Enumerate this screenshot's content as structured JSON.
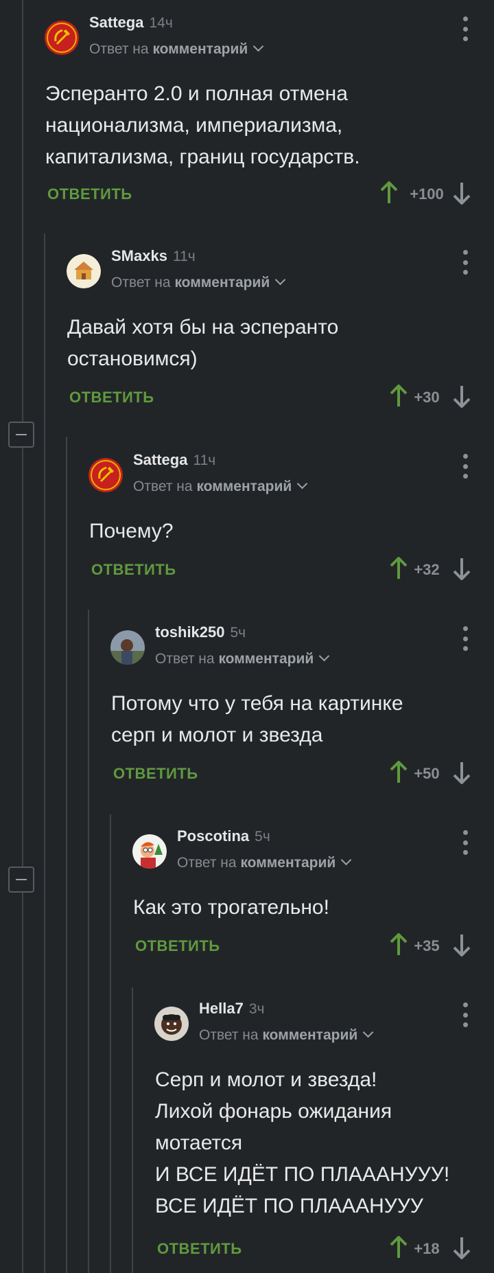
{
  "comments": [
    {
      "author": "Sattega",
      "time": "14ч",
      "reply_prefix": "Ответ на",
      "reply_target": "комментарий",
      "lines": [
        "Эсперанто 2.0 и полная отмена",
        "национализма, империализма,",
        "капитализма, границ государств."
      ],
      "reply_label": "ОТВЕТИТЬ",
      "score": "+100",
      "avatar_icon": "hammer-sickle-icon"
    },
    {
      "author": "SMaxks",
      "time": "11ч",
      "reply_prefix": "Ответ на",
      "reply_target": "комментарий",
      "lines": [
        "Давай хотя бы на эсперанто",
        "остановимся)"
      ],
      "reply_label": "ОТВЕТИТЬ",
      "score": "+30",
      "avatar_icon": "house-icon"
    },
    {
      "author": "Sattega",
      "time": "11ч",
      "reply_prefix": "Ответ на",
      "reply_target": "комментарий",
      "lines": [
        "Почему?"
      ],
      "reply_label": "ОТВЕТИТЬ",
      "score": "+32",
      "avatar_icon": "hammer-sickle-icon"
    },
    {
      "author": "toshik250",
      "time": "5ч",
      "reply_prefix": "Ответ на",
      "reply_target": "комментарий",
      "lines": [
        "Потому что у тебя на картинке",
        "серп и молот и звезда"
      ],
      "reply_label": "ОТВЕТИТЬ",
      "score": "+50",
      "avatar_icon": "photo-avatar-icon"
    },
    {
      "author": "Poscotina",
      "time": "5ч",
      "reply_prefix": "Ответ на",
      "reply_target": "комментарий",
      "lines": [
        "Как это трогательно!"
      ],
      "reply_label": "ОТВЕТИТЬ",
      "score": "+35",
      "avatar_icon": "cartoon-avatar-icon"
    },
    {
      "author": "Hella7",
      "time": "3ч",
      "reply_prefix": "Ответ на",
      "reply_target": "комментарий",
      "lines": [
        "Серп и молот и звезда!",
        "Лихой фонарь ожидания",
        "мотается",
        "И ВСЕ ИДЁТ ПО ПЛАААНУУУ!",
        "ВСЕ ИДЁТ ПО ПЛАААНУУУ"
      ],
      "reply_label": "ОТВЕТИТЬ",
      "score": "+18",
      "avatar_icon": "photo-avatar-icon"
    }
  ],
  "colors": {
    "background": "#222528",
    "reply_link": "#5f9a3f",
    "upvote": "#5f9a3f",
    "downvote": "#8d9297"
  },
  "icons": {
    "collapse": "minus-icon",
    "menu": "kebab-menu-icon",
    "upvote": "arrow-up-icon",
    "downvote": "arrow-down-icon",
    "dropdown": "chevron-down-icon"
  }
}
